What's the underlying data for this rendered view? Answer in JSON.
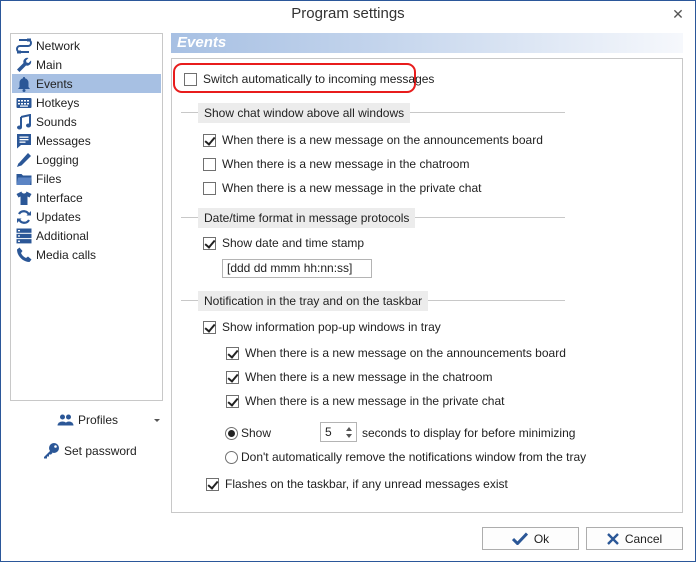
{
  "window": {
    "title": "Program settings",
    "close_icon": "close-icon"
  },
  "sidebar": {
    "items": [
      {
        "label": "Network",
        "icon": "network-cable-icon",
        "active": false
      },
      {
        "label": "Main",
        "icon": "wrench-icon",
        "active": false
      },
      {
        "label": "Events",
        "icon": "bell-icon",
        "active": true
      },
      {
        "label": "Hotkeys",
        "icon": "keyboard-icon",
        "active": false
      },
      {
        "label": "Sounds",
        "icon": "music-note-icon",
        "active": false
      },
      {
        "label": "Messages",
        "icon": "message-icon",
        "active": false
      },
      {
        "label": "Logging",
        "icon": "pencil-icon",
        "active": false
      },
      {
        "label": "Files",
        "icon": "folder-icon",
        "active": false
      },
      {
        "label": "Interface",
        "icon": "tshirt-icon",
        "active": false
      },
      {
        "label": "Updates",
        "icon": "refresh-icon",
        "active": false
      },
      {
        "label": "Additional",
        "icon": "server-list-icon",
        "active": false
      },
      {
        "label": "Media calls",
        "icon": "phone-icon",
        "active": false
      }
    ],
    "profiles_label": "Profiles",
    "set_password_label": "Set password"
  },
  "panel": {
    "header": "Events",
    "switch_auto": {
      "label": "Switch automatically to incoming messages",
      "checked": false
    },
    "group_chat_window": {
      "title": "Show chat window above all windows",
      "options": [
        {
          "label": "When there is a new message on the announcements board",
          "checked": true
        },
        {
          "label": "When there is a new message in the chatroom",
          "checked": false
        },
        {
          "label": "When there is a new message in the private chat",
          "checked": false
        }
      ]
    },
    "group_datetime": {
      "title": "Date/time format in message protocols",
      "show_stamp": {
        "label": "Show date and time stamp",
        "checked": true
      },
      "format_value": "[ddd dd mmm hh:nn:ss]"
    },
    "group_tray": {
      "title": "Notification in the tray and on the taskbar",
      "show_popups": {
        "label": "Show information pop-up windows in tray",
        "checked": true
      },
      "options": [
        {
          "label": "When there is a new message on the announcements board",
          "checked": true
        },
        {
          "label": "When there is a new message in the chatroom",
          "checked": true
        },
        {
          "label": "When there is a new message in the private chat",
          "checked": true
        }
      ],
      "radio_show": {
        "label": "Show",
        "selected": true
      },
      "seconds_value": "5",
      "seconds_suffix": "seconds to display for before minimizing",
      "radio_dont_remove": {
        "label": "Don't automatically remove the notifications window from the tray",
        "selected": false
      },
      "flashes": {
        "label": "Flashes on the taskbar, if any unread messages exist",
        "checked": true
      }
    }
  },
  "buttons": {
    "ok_label": "Ok",
    "cancel_label": "Cancel"
  },
  "colors": {
    "accent": "#2b579a",
    "selection": "#a7c0e3",
    "highlight_border": "#e81c1c",
    "icon_blue": "#2b5797"
  }
}
